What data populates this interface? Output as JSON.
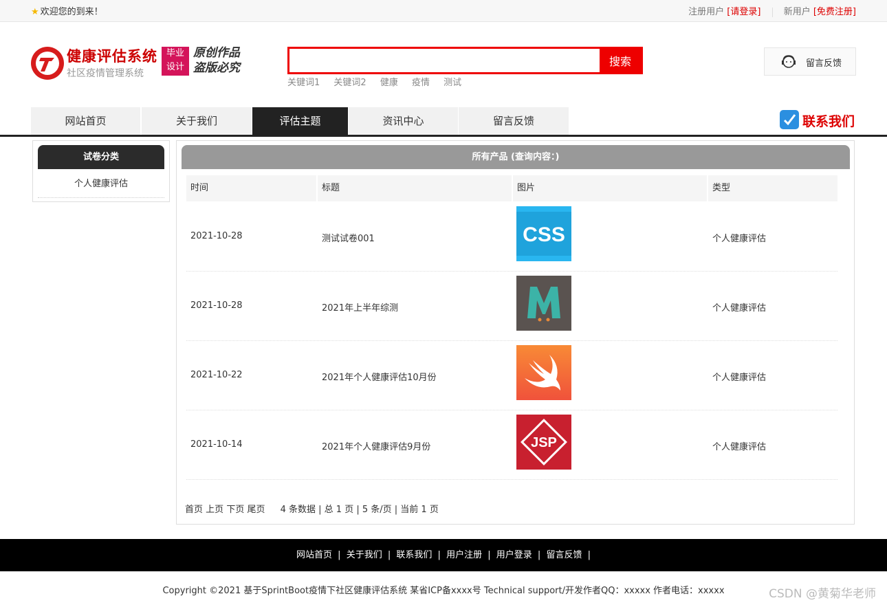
{
  "topbar": {
    "welcome": "欢迎您的到来！",
    "register_prefix": "注册用户",
    "login_link": "[请登录]",
    "new_user_prefix": "新用户",
    "signup_link": "[免费注册]"
  },
  "logo": {
    "title": "健康评估系统",
    "subtitle": "社区疫情管理系统",
    "badge_line1": "毕业",
    "badge_line2": "设计",
    "slogan_line1": "原创作品",
    "slogan_line2": "盗版必究"
  },
  "search": {
    "placeholder": "",
    "button": "搜索",
    "hotwords": [
      "关键词1",
      "关键词2",
      "健康",
      "疫情",
      "测试"
    ]
  },
  "feedback_box": {
    "label": "留言反馈"
  },
  "nav": {
    "items": [
      "网站首页",
      "关于我们",
      "评估主题",
      "资讯中心",
      "留言反馈"
    ],
    "active_index": 2,
    "contact": "联系我们"
  },
  "sidebar": {
    "heading": "试卷分类",
    "items": [
      "个人健康评估"
    ]
  },
  "main": {
    "heading": "所有产品 (查询内容：)",
    "columns": [
      "时间",
      "标题",
      "图片",
      "类型"
    ],
    "rows": [
      {
        "date": "2021-10-28",
        "title": "测试试卷001",
        "image": "css-logo",
        "type": "个人健康评估"
      },
      {
        "date": "2021-10-28",
        "title": "2021年上半年综测",
        "image": "meteor-logo",
        "type": "个人健康评估"
      },
      {
        "date": "2021-10-22",
        "title": "2021年个人健康评估10月份",
        "image": "swift-logo",
        "type": "个人健康评估"
      },
      {
        "date": "2021-10-14",
        "title": "2021年个人健康评估9月份",
        "image": "jsp-logo",
        "type": "个人健康评估"
      }
    ],
    "pager": {
      "first": "首页",
      "prev": "上页",
      "next": "下页",
      "last": "尾页",
      "summary": "4 条数据 | 总 1 页 | 5 条/页 | 当前 1 页"
    }
  },
  "footer": {
    "links": [
      "网站首页",
      "关于我们",
      "联系我们",
      "用户注册",
      "用户登录",
      "留言反馈"
    ],
    "separator": "|",
    "copyright": "Copyright ©2021 基于SprintBoot疫情下社区健康评估系统   某省ICP备xxxx号   Technical support/开发作者QQ：xxxxx     作者电话：xxxxx",
    "watermark": "CSDN @黄菊华老师"
  },
  "colors": {
    "accent_red": "#e00000",
    "nav_active": "#222222",
    "footer_bg": "#000000"
  }
}
